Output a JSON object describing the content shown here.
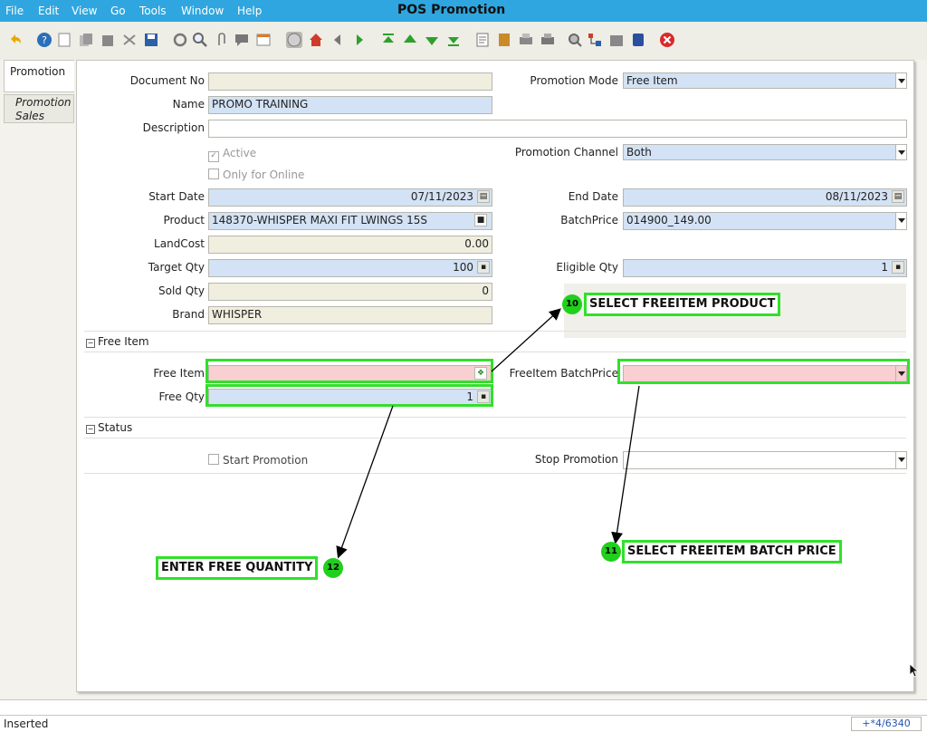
{
  "window": {
    "title": "POS Promotion"
  },
  "menu": [
    {
      "label": "File"
    },
    {
      "label": "Edit"
    },
    {
      "label": "View"
    },
    {
      "label": "Go"
    },
    {
      "label": "Tools"
    },
    {
      "label": "Window"
    },
    {
      "label": "Help"
    }
  ],
  "tabs": [
    {
      "label": "Promotion"
    },
    {
      "label": "Promotion Sales"
    }
  ],
  "form": {
    "document_no": {
      "label": "Document No",
      "value": ""
    },
    "promotion_mode": {
      "label": "Promotion Mode",
      "value": "Free Item"
    },
    "name": {
      "label": "Name",
      "value": "PROMO TRAINING"
    },
    "description": {
      "label": "Description",
      "value": ""
    },
    "active": {
      "label": "Active",
      "checked": true
    },
    "only_online": {
      "label": "Only for Online",
      "checked": false
    },
    "promotion_channel": {
      "label": "Promotion Channel",
      "value": "Both"
    },
    "start_date": {
      "label": "Start Date",
      "value": "07/11/2023"
    },
    "end_date": {
      "label": "End Date",
      "value": "08/11/2023"
    },
    "product": {
      "label": "Product",
      "value": "148370-WHISPER MAXI FIT LWINGS 15S"
    },
    "batch_price": {
      "label": "BatchPrice",
      "value": "014900_149.00"
    },
    "land_cost": {
      "label": "LandCost",
      "value": "0.00"
    },
    "target_qty": {
      "label": "Target Qty",
      "value": "100"
    },
    "eligible_qty": {
      "label": "Eligible Qty",
      "value": "1"
    },
    "sold_qty": {
      "label": "Sold Qty",
      "value": "0"
    },
    "brand": {
      "label": "Brand",
      "value": "WHISPER"
    }
  },
  "sections": {
    "free_item": "Free Item",
    "status": "Status"
  },
  "free_item": {
    "free_item": {
      "label": "Free Item",
      "value": ""
    },
    "freeitem_batchprice": {
      "label": "FreeItem BatchPrice",
      "value": ""
    },
    "free_qty": {
      "label": "Free Qty",
      "value": "1"
    }
  },
  "status_section": {
    "start_promotion": {
      "label": "Start Promotion",
      "checked": false
    },
    "stop_promotion": {
      "label": "Stop Promotion",
      "value": ""
    }
  },
  "callouts": [
    {
      "num": "10",
      "text": "SELECT FREEITEM PRODUCT"
    },
    {
      "num": "11",
      "text": "SELECT FREEITEM BATCH PRICE"
    },
    {
      "num": "12",
      "text": "ENTER FREE QUANTITY"
    }
  ],
  "statusbar": {
    "text": "Inserted",
    "record": "+*4/6340"
  },
  "colors": {
    "titlebar": "#2fa6df",
    "highlight": "#31e02b",
    "mandatory": "#d3e2f4",
    "readonly": "#efeedf",
    "error": "#f9cfd1"
  }
}
